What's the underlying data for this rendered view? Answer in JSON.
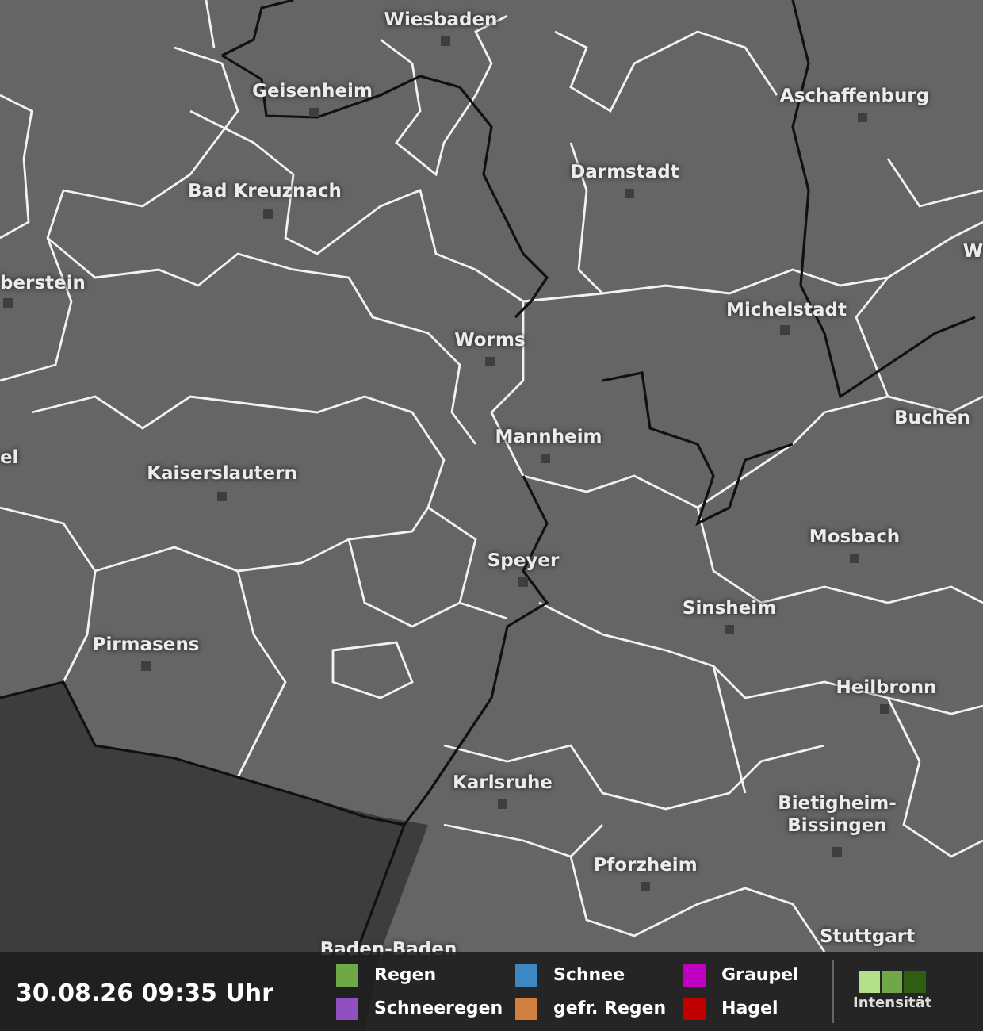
{
  "map": {
    "cities": [
      {
        "name": "Wiesbaden"
      },
      {
        "name": "Geisenheim"
      },
      {
        "name": "Aschaffenburg"
      },
      {
        "name": "Darmstadt"
      },
      {
        "name": "Bad Kreuznach"
      },
      {
        "name": "W"
      },
      {
        "name": "berstein"
      },
      {
        "name": "Michelstadt"
      },
      {
        "name": "Worms"
      },
      {
        "name": "Buchen"
      },
      {
        "name": "Mannheim"
      },
      {
        "name": "el"
      },
      {
        "name": "Kaiserslautern"
      },
      {
        "name": "Mosbach"
      },
      {
        "name": "Speyer"
      },
      {
        "name": "Sinsheim"
      },
      {
        "name": "Pirmasens"
      },
      {
        "name": "Heilbronn"
      },
      {
        "name": "Karlsruhe"
      },
      {
        "name": "Bietigheim-Bissingen"
      },
      {
        "name": "Pforzheim"
      },
      {
        "name": "Stuttgart"
      },
      {
        "name": "Baden-Baden"
      }
    ]
  },
  "timestamp": "30.08.26 09:35 Uhr",
  "legend": {
    "items": [
      {
        "label": "Regen",
        "color": "#70a848"
      },
      {
        "label": "Schnee",
        "color": "#3f87c0"
      },
      {
        "label": "Graupel",
        "color": "#c000c0"
      },
      {
        "label": "Schneeregen",
        "color": "#9050c0"
      },
      {
        "label": "gefr. Regen",
        "color": "#d08040"
      },
      {
        "label": "Hagel",
        "color": "#c00000"
      }
    ],
    "intensity_label": "Intensität"
  }
}
